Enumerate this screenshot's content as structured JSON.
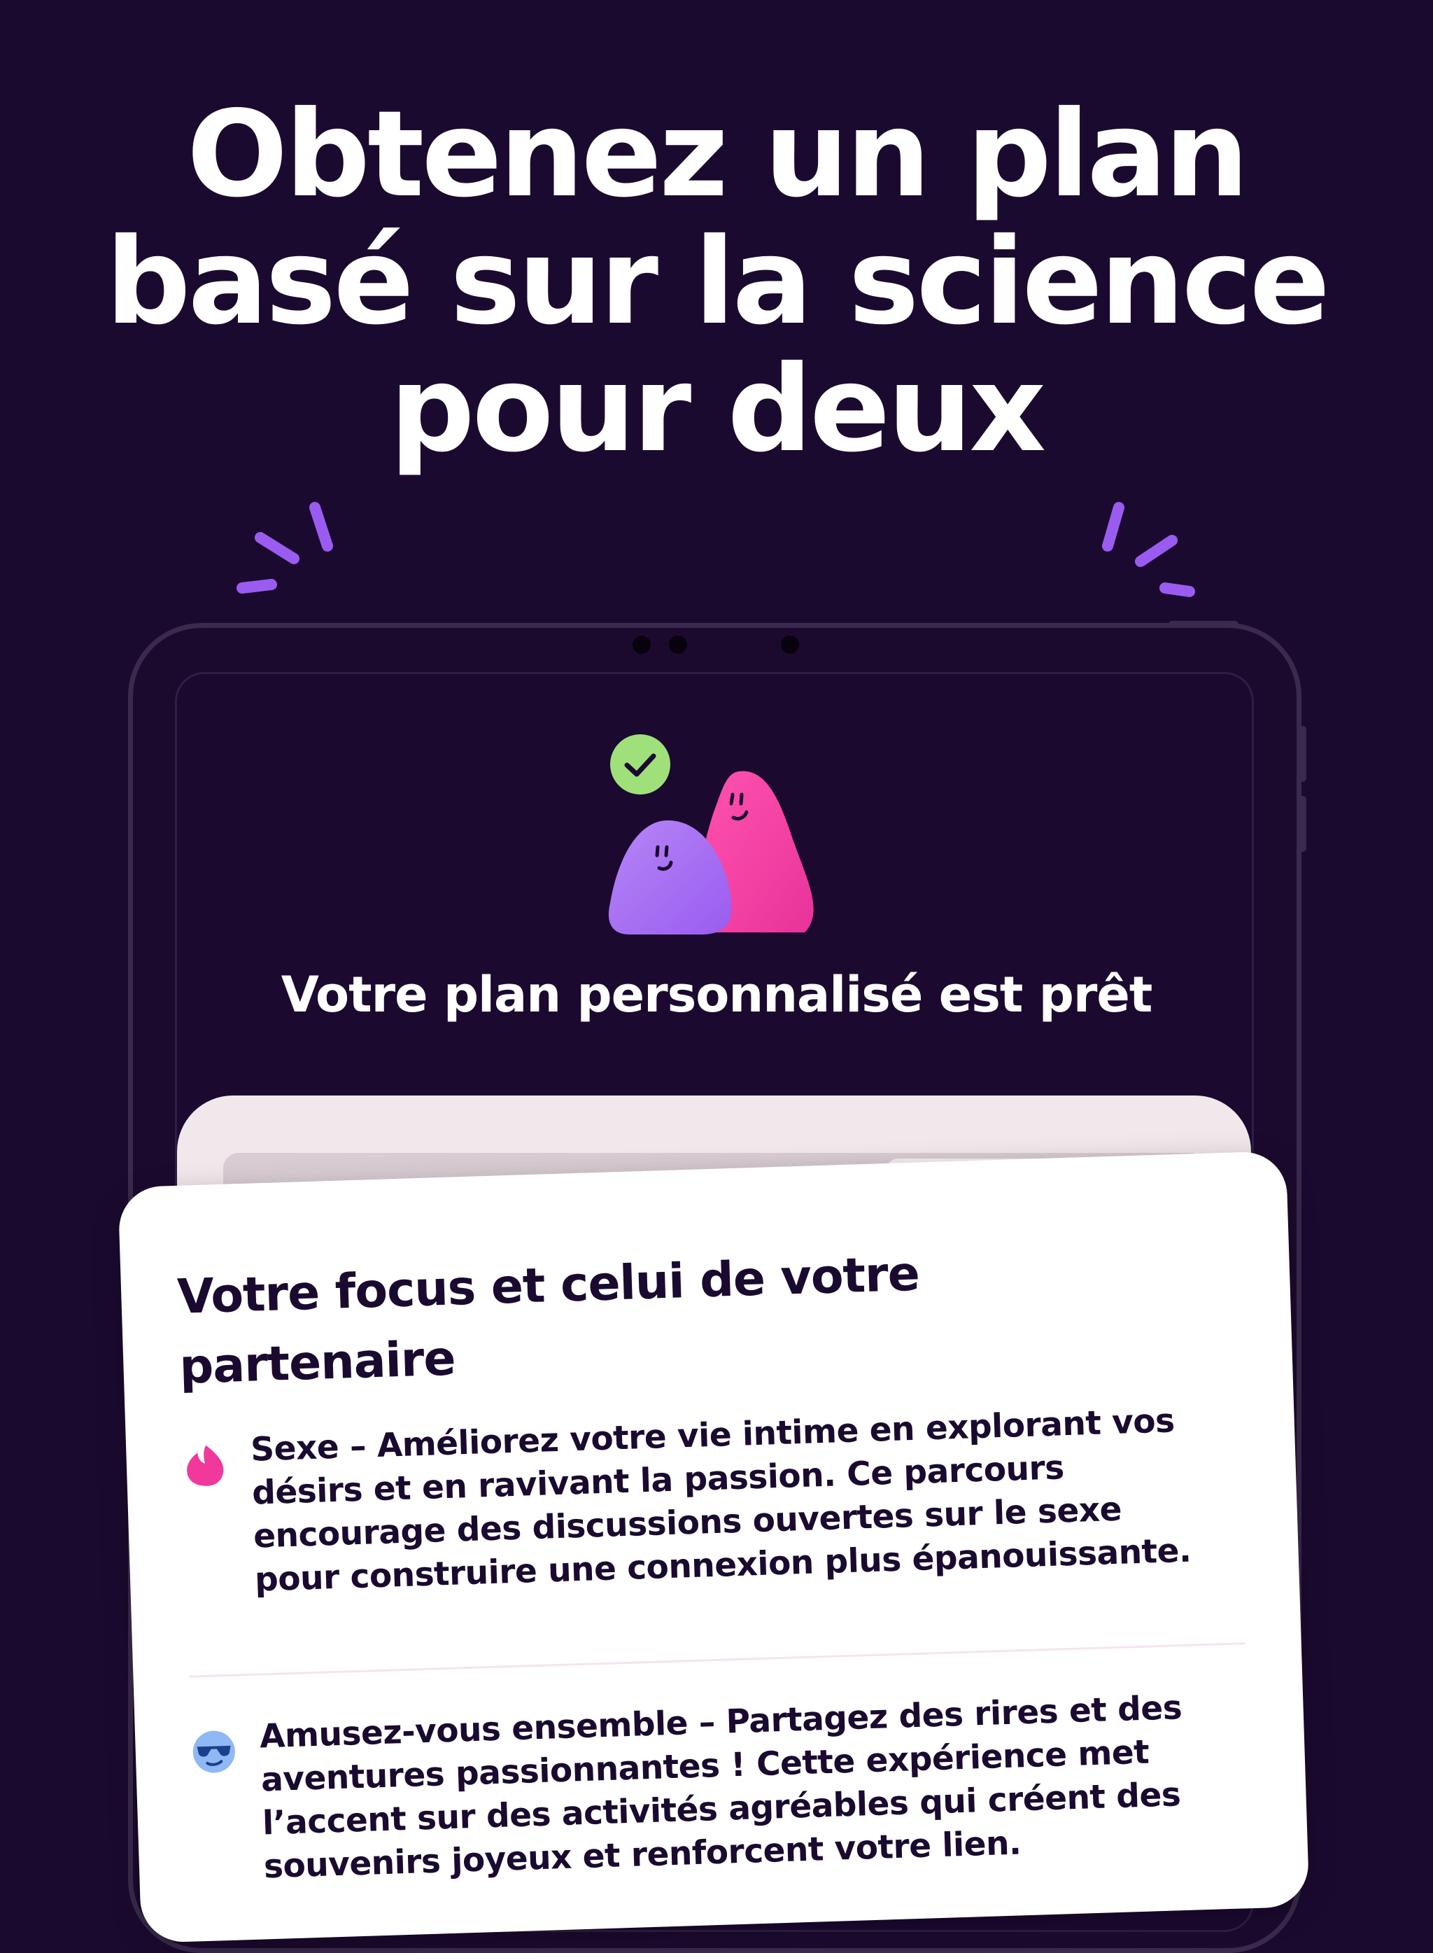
{
  "headline": {
    "line1": "Obtenez un plan",
    "line2": "basé sur la science",
    "line3": "pour deux"
  },
  "screen": {
    "title": "Votre plan personnalisé est prêt",
    "success_badge": "check-icon"
  },
  "card": {
    "title_line1": "Votre focus et celui de votre",
    "title_line2": "partenaire",
    "items": [
      {
        "icon": "flame-icon",
        "line1": "Sexe – Améliorez votre vie intime en explorant vos",
        "line2": "désirs et en ravivant la passion. Ce parcours",
        "line3": "encourage des discussions ouvertes sur le sexe",
        "line4": "pour construire une connexion plus épanouissante."
      },
      {
        "icon": "sunglasses-face-icon",
        "line1": "Amusez-vous ensemble – Partagez des rires et des",
        "line2": "aventures passionnantes ! Cette expérience met",
        "line3": "l’accent sur des activités agréables qui créent des",
        "line4": "souvenirs joyeux et renforcent votre lien."
      }
    ]
  },
  "colors": {
    "background": "#1b0a30",
    "accent_purple": "#9a5cf0",
    "accent_pink": "#f0399a",
    "success_green": "#9fe07a",
    "card": "#ffffff",
    "card_back": "#f1e8ec"
  }
}
